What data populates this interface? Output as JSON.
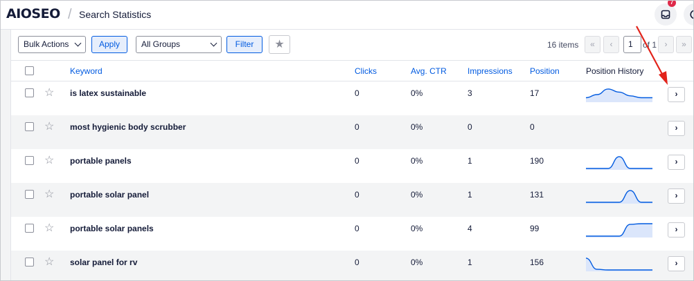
{
  "header": {
    "logo_text": "AIOSEO",
    "separator": "/",
    "page_title": "Search Statistics",
    "notification_count": "7"
  },
  "toolbar": {
    "bulk_actions": "Bulk Actions",
    "apply": "Apply",
    "groups": "All Groups",
    "filter": "Filter",
    "items_count": "16 items",
    "first": "«",
    "prev": "‹",
    "page": "1",
    "of": "of 1",
    "next": "›",
    "last": "»"
  },
  "table": {
    "columns": {
      "keyword": "Keyword",
      "clicks": "Clicks",
      "ctr": "Avg. CTR",
      "impressions": "Impressions",
      "position": "Position",
      "history": "Position History"
    },
    "rows": [
      {
        "keyword": "is latex sustainable",
        "clicks": "0",
        "ctr": "0%",
        "impressions": "3",
        "position": "17",
        "history": [
          0.25,
          0.5,
          0.95,
          0.7,
          0.4,
          0.25,
          0.25
        ]
      },
      {
        "keyword": "most hygienic body scrubber",
        "clicks": "0",
        "ctr": "0%",
        "impressions": "0",
        "position": "0",
        "history": []
      },
      {
        "keyword": "portable panels",
        "clicks": "0",
        "ctr": "0%",
        "impressions": "1",
        "position": "190",
        "history": [
          0,
          0,
          0,
          0.95,
          0,
          0,
          0
        ]
      },
      {
        "keyword": "portable solar panel",
        "clicks": "0",
        "ctr": "0%",
        "impressions": "1",
        "position": "131",
        "history": [
          0,
          0,
          0,
          0,
          0.95,
          0,
          0
        ]
      },
      {
        "keyword": "portable solar panels",
        "clicks": "0",
        "ctr": "0%",
        "impressions": "4",
        "position": "99",
        "history": [
          0,
          0,
          0,
          0,
          0.95,
          1,
          1
        ]
      },
      {
        "keyword": "solar panel for rv",
        "clicks": "0",
        "ctr": "0%",
        "impressions": "1",
        "position": "156",
        "history": [
          0.95,
          0.05,
          0,
          0,
          0,
          0,
          0
        ]
      }
    ]
  },
  "icons": {
    "star": "☆",
    "star_filled": "★",
    "chevron_right": "›"
  },
  "colors": {
    "accent": "#005ae0",
    "annotation_arrow": "#e2231a",
    "sparkline": "#005ae0"
  }
}
